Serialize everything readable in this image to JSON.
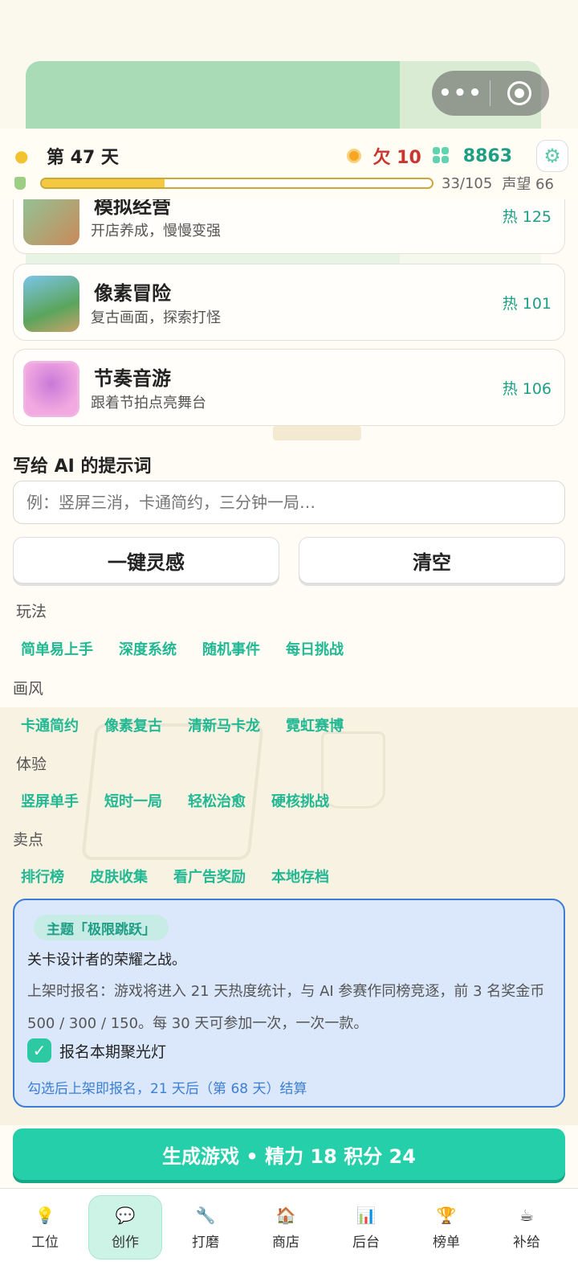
{
  "header": {
    "day_label": "第 47 天",
    "debt_label": "欠 10",
    "gems_value": "8863",
    "progress_text": "33/105",
    "progress_fraction": 0.314,
    "reputation_text": "声望 66"
  },
  "genres": [
    {
      "title": "模拟经营",
      "subtitle": "开店养成，慢慢变强",
      "hot": "热 125"
    },
    {
      "title": "像素冒险",
      "subtitle": "复古画面，探索打怪",
      "hot": "热 101"
    },
    {
      "title": "节奏音游",
      "subtitle": "跟着节拍点亮舞台",
      "hot": "热 106"
    }
  ],
  "prompt": {
    "section_title": "写给 AI 的提示词",
    "placeholder": "例：竖屏三消，卡通简约，三分钟一局…",
    "inspire_button": "一键灵感",
    "clear_button": "清空"
  },
  "tag_groups": [
    {
      "label": "玩法",
      "tags": [
        "简单易上手",
        "深度系统",
        "随机事件",
        "每日挑战"
      ]
    },
    {
      "label": "画风",
      "tags": [
        "卡通简约",
        "像素复古",
        "清新马卡龙",
        "霓虹赛博"
      ]
    },
    {
      "label": "体验",
      "tags": [
        "竖屏单手",
        "短时一局",
        "轻松治愈",
        "硬核挑战"
      ]
    },
    {
      "label": "卖点",
      "tags": [
        "排行榜",
        "皮肤收集",
        "看广告奖励",
        "本地存档"
      ]
    }
  ],
  "theme": {
    "pill": "主题「极限跳跃」",
    "slogan": "关卡设计者的荣耀之战。",
    "description": "上架时报名：游戏将进入 21 天热度统计，与 AI 参赛作同榜竞逐，前 3 名奖金币 500 / 300 / 150。每 30 天可参加一次，一次一款。",
    "checkbox_label": "报名本期聚光灯",
    "checked": true,
    "note": "勾选后上架即报名，21 天后（第 68 天）结算"
  },
  "generate_button": "生成游戏 • 精力 18 积分 24",
  "nav": [
    {
      "label": "工位",
      "icon": "lightbulb-icon",
      "glyph": "💡"
    },
    {
      "label": "创作",
      "icon": "chat-icon",
      "glyph": "💬"
    },
    {
      "label": "打磨",
      "icon": "wrench-icon",
      "glyph": "🔧"
    },
    {
      "label": "商店",
      "icon": "store-icon",
      "glyph": "🏠"
    },
    {
      "label": "后台",
      "icon": "chart-icon",
      "glyph": "📊"
    },
    {
      "label": "榜单",
      "icon": "trophy-icon",
      "glyph": "🏆"
    },
    {
      "label": "补给",
      "icon": "cup-icon",
      "glyph": "☕"
    }
  ],
  "colors": {
    "accent": "#24cfaa",
    "tag_text": "#21b893",
    "debt_red": "#c9362f",
    "theme_blue": "#3c7ed4"
  }
}
